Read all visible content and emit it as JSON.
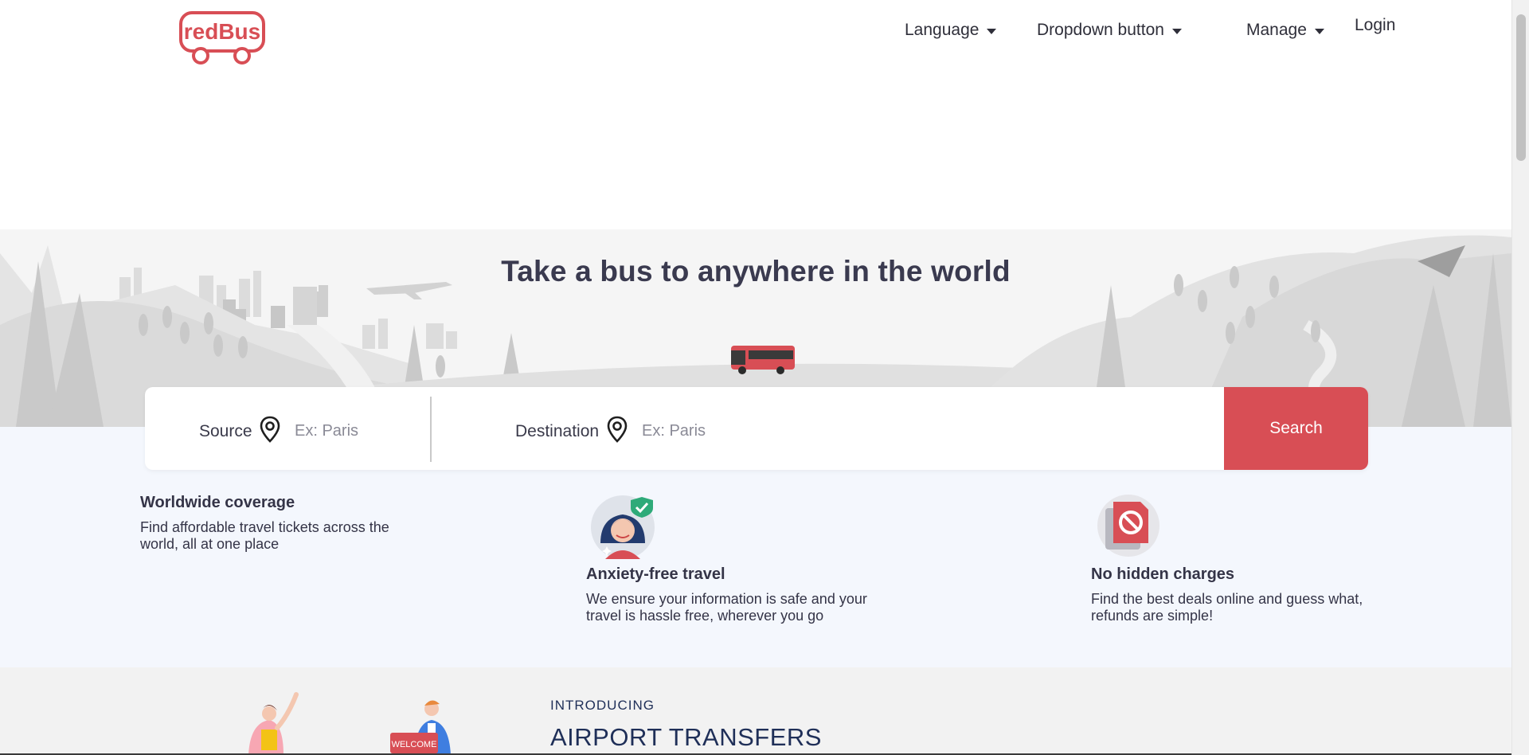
{
  "brand": {
    "name": "redBus",
    "accent": "#d84e55"
  },
  "nav": {
    "language": "Language",
    "dropdown": "Dropdown button",
    "manage": "Manage",
    "login": "Login"
  },
  "hero": {
    "title": "Take a bus to anywhere in the world"
  },
  "search": {
    "source_label": "Source",
    "source_placeholder": "Ex: Paris",
    "destination_label": "Destination",
    "destination_placeholder": "Ex: Paris",
    "button_label": "Search"
  },
  "features": [
    {
      "title": "Worldwide coverage",
      "desc": "Find affordable travel tickets across the world, all at one place"
    },
    {
      "title": "Anxiety-free travel",
      "desc": "We ensure your information is safe and your travel is hassle free, wherever you go",
      "icon": "anxiety-free-traveler-icon"
    },
    {
      "title": "No hidden charges",
      "desc": "Find the best deals online and guess what, refunds are simple!",
      "icon": "no-hidden-charges-icon"
    }
  ],
  "airport": {
    "intro": "INTRODUCING",
    "title": "AIRPORT TRANSFERS",
    "sign": "WELCOME"
  }
}
